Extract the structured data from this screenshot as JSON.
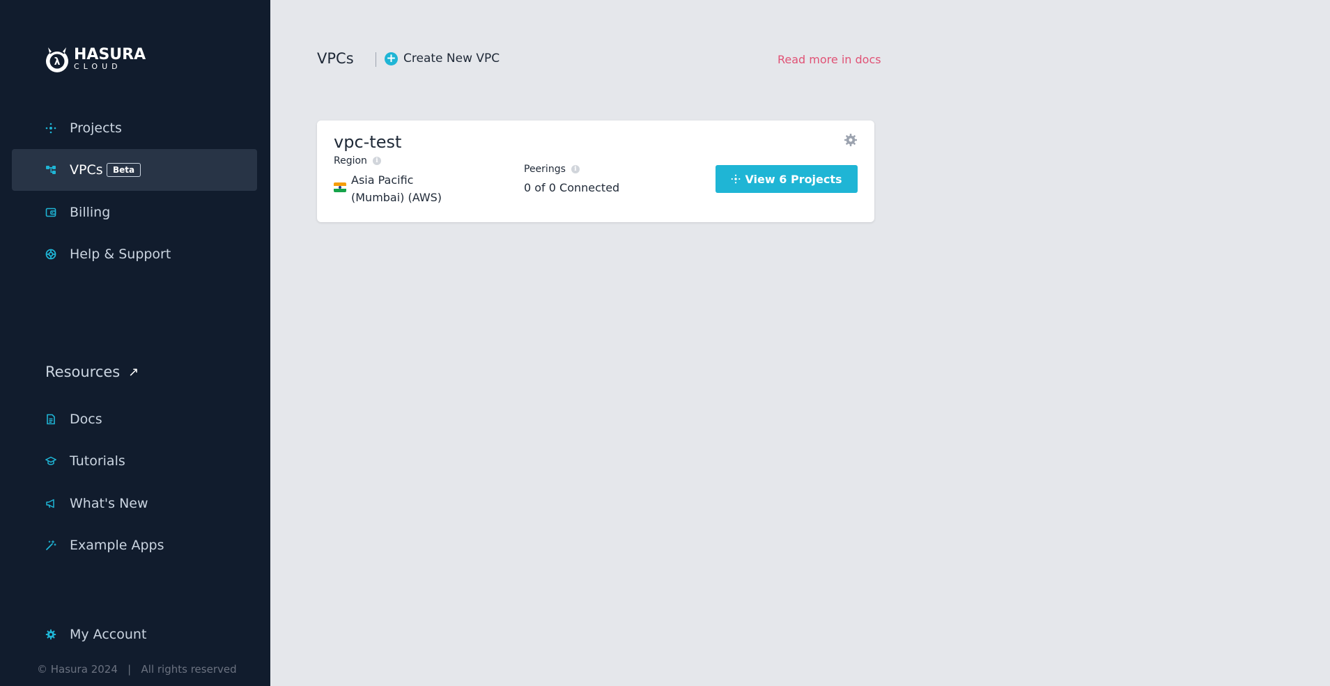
{
  "sidebar": {
    "logo": {
      "line1": "HASURA",
      "line2": "CLOUD"
    },
    "nav": [
      {
        "label": "Projects",
        "icon": "projects-icon"
      },
      {
        "label": "VPCs",
        "icon": "vpc-icon",
        "badge": "Beta",
        "active": true
      },
      {
        "label": "Billing",
        "icon": "wallet-icon"
      },
      {
        "label": "Help & Support",
        "icon": "lifebuoy-icon"
      }
    ],
    "resources_heading": "Resources",
    "resources": [
      {
        "label": "Docs",
        "icon": "document-icon"
      },
      {
        "label": "Tutorials",
        "icon": "graduation-cap-icon"
      },
      {
        "label": "What's New",
        "icon": "megaphone-icon"
      },
      {
        "label": "Example Apps",
        "icon": "magic-wand-icon"
      }
    ],
    "account": {
      "label": "My Account",
      "icon": "gear-icon"
    },
    "footer": "© Hasura 2024   |   All rights reserved"
  },
  "header": {
    "title": "VPCs",
    "create_label": "Create New VPC",
    "docs_link": "Read more in docs"
  },
  "vpc_card": {
    "name": "vpc-test",
    "region_label": "Region",
    "region_line1": "Asia Pacific",
    "region_line2": "(Mumbai) (AWS)",
    "peerings_label": "Peerings",
    "peerings_value": "0 of 0 Connected",
    "view_button": "View 6 Projects"
  },
  "colors": {
    "sidebar_bg": "#111c2d",
    "accent": "#1fb5d5",
    "link": "#e05275",
    "main_bg": "#e5e7eb"
  }
}
